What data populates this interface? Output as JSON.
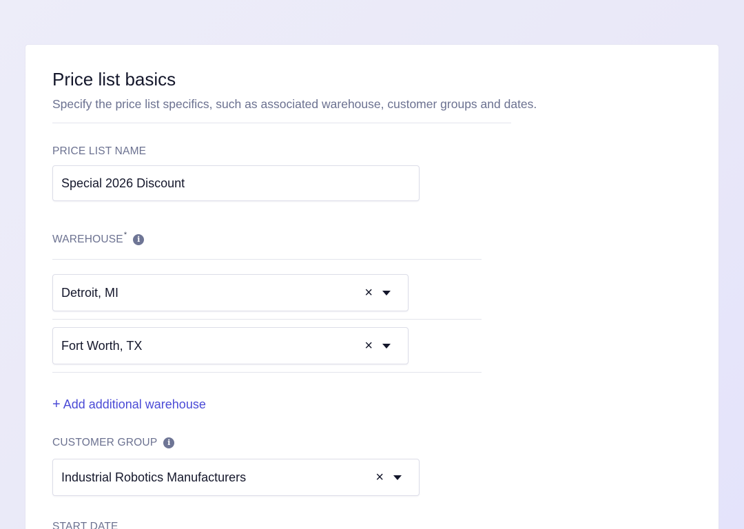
{
  "section": {
    "title": "Price list basics",
    "subtitle": "Specify the price list specifics, such as associated warehouse, customer groups and dates."
  },
  "price_list_name": {
    "label": "PRICE LIST NAME",
    "value": "Special 2026 Discount"
  },
  "warehouse": {
    "label": "WAREHOUSE",
    "required_mark": "*",
    "info_icon": "i",
    "items": [
      {
        "value": "Detroit, MI",
        "clear_icon": "×"
      },
      {
        "value": "Fort Worth, TX",
        "clear_icon": "×"
      }
    ],
    "add_label": "Add additional warehouse",
    "add_icon": "+"
  },
  "customer_group": {
    "label": "CUSTOMER GROUP",
    "info_icon": "i",
    "value": "Industrial Robotics Manufacturers",
    "clear_icon": "×"
  },
  "start_date": {
    "label": "START DATE"
  },
  "colors": {
    "accent": "#4a4ad6",
    "text": "#14172b",
    "muted": "#6b7190",
    "background": "#ebeaf8"
  }
}
